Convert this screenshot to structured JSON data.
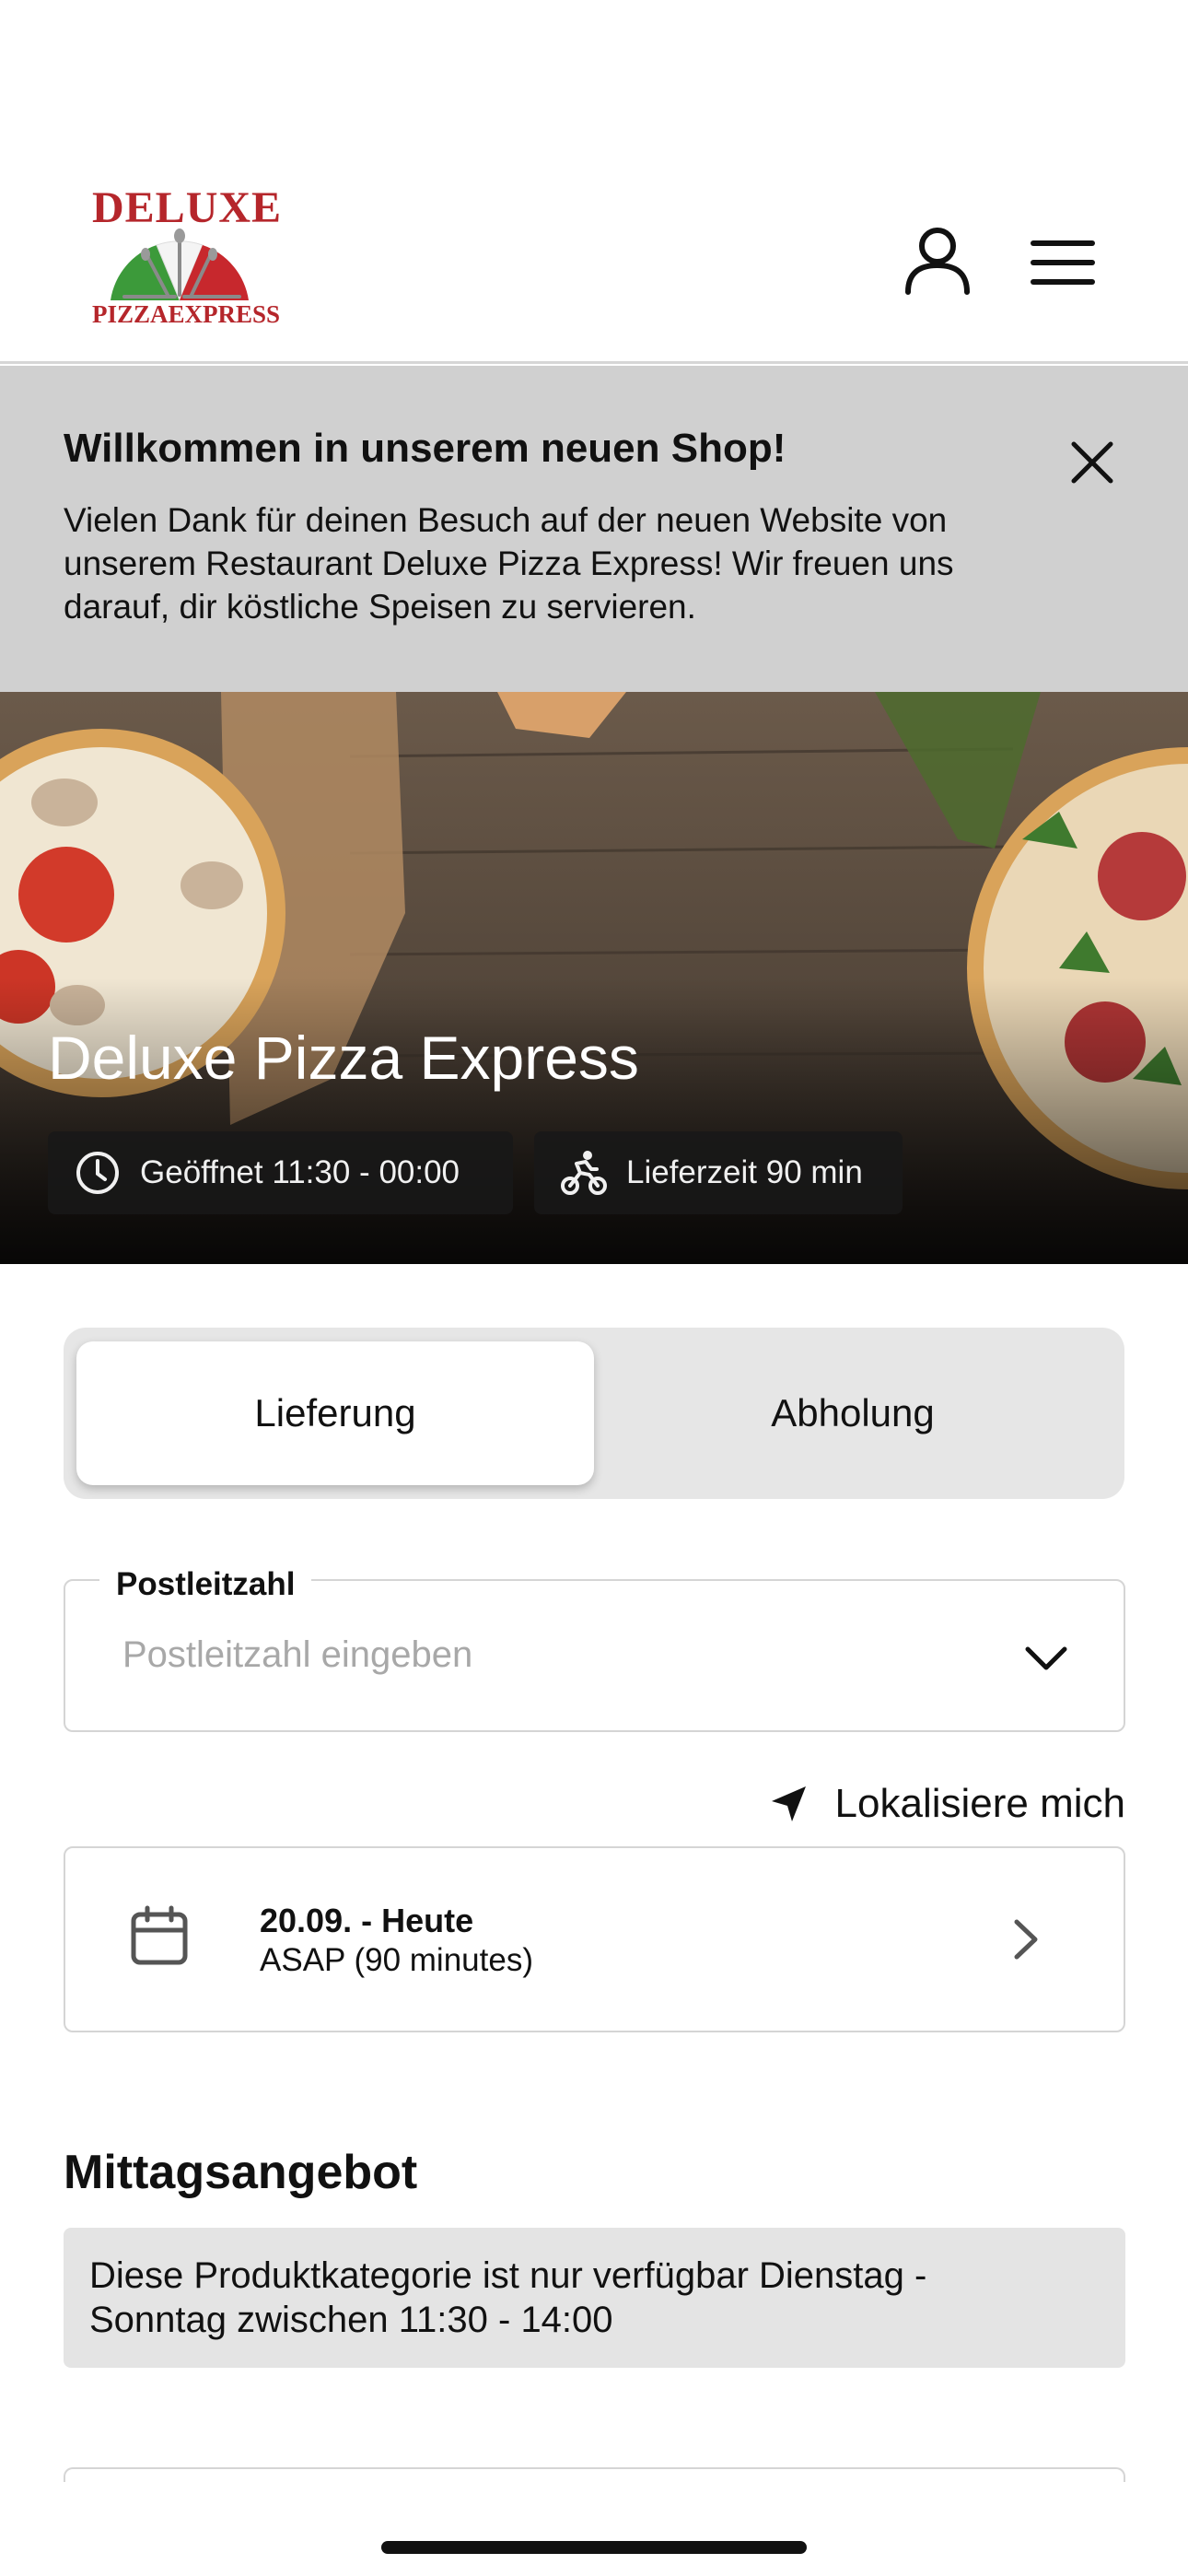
{
  "header": {
    "logo": {
      "top_word": "DELUXE",
      "bottom_word": "PIZZAEXPRESS"
    },
    "icons": {
      "account": "user-icon",
      "menu": "hamburger-menu-icon"
    }
  },
  "banner": {
    "title": "Willkommen in unserem neuen Shop!",
    "text": "Vielen Dank für deinen Besuch auf der neuen Website von unserem Restaurant Deluxe Pizza Express! Wir freuen uns darauf, dir köstliche Speisen zu servieren.",
    "close_icon": "close-icon"
  },
  "hero": {
    "restaurant_name": "Deluxe Pizza Express",
    "opening_hours": "Geöffnet 11:30 - 00:00",
    "delivery_time": "Lieferzeit 90 min"
  },
  "order_mode": {
    "options": [
      "Lieferung",
      "Abholung"
    ],
    "selected": "Lieferung"
  },
  "postcode": {
    "label": "Postleitzahl",
    "placeholder": "Postleitzahl eingeben",
    "value": ""
  },
  "locate": {
    "label": "Lokalisiere mich"
  },
  "schedule": {
    "date": "20.09. - Heute",
    "time": "ASAP (90 minutes)"
  },
  "category": {
    "title": "Mittagsangebot",
    "notice": "Diese Produktkategorie ist nur verfügbar Dienstag - Sonntag zwischen 11:30 - 14:00"
  },
  "colors": {
    "brand_red": "#b5262b",
    "brand_green": "#3c9a3a",
    "banner_bg": "#d0d0d0",
    "toggle_bg": "#e6e6e6"
  }
}
